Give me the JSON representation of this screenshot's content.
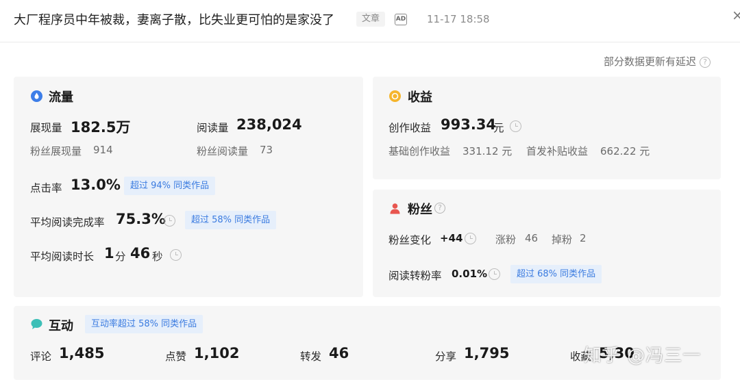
{
  "header": {
    "title": "大厂程序员中年被裁，妻离子散，比失业更可怕的是家没了",
    "type_tag": "文章",
    "ad_badge": "AD",
    "time": "11-17 18:58",
    "close_symbol": "×"
  },
  "delay_note": "部分数据更新有延迟",
  "help_symbol": "?",
  "flow": {
    "title": "流量",
    "impressions_label": "展现量",
    "impressions_value": "182.5万",
    "reads_label": "阅读量",
    "reads_value": "238,024",
    "fan_impressions_label": "粉丝展现量",
    "fan_impressions_value": "914",
    "fan_reads_label": "粉丝阅读量",
    "fan_reads_value": "73",
    "ctr_label": "点击率",
    "ctr_value": "13.0%",
    "ctr_badge": "超过 94% 同类作品",
    "completion_label": "平均阅读完成率",
    "completion_value": "75.3%",
    "completion_badge": "超过 58% 同类作品",
    "duration_label": "平均阅读时长",
    "duration_min": "1",
    "duration_min_unit": "分",
    "duration_sec": "46",
    "duration_sec_unit": "秒"
  },
  "income": {
    "title": "收益",
    "creation_label": "创作收益",
    "creation_value": "993.34",
    "creation_unit": "元",
    "base_label": "基础创作收益",
    "base_value": "331.12 元",
    "subsidy_label": "首发补贴收益",
    "subsidy_value": "662.22 元"
  },
  "fans": {
    "title": "粉丝",
    "change_label": "粉丝变化",
    "change_value": "+44",
    "gain_label": "涨粉",
    "gain_value": "46",
    "loss_label": "掉粉",
    "loss_value": "2",
    "convert_label": "阅读转粉率",
    "convert_value": "0.01%",
    "convert_badge": "超过 68% 同类作品"
  },
  "interaction": {
    "title": "互动",
    "badge": "互动率超过 58% 同类作品",
    "comments_label": "评论",
    "comments_value": "1,485",
    "likes_label": "点赞",
    "likes_value": "1,102",
    "reposts_label": "转发",
    "reposts_value": "46",
    "shares_label": "分享",
    "shares_value": "1,795",
    "favorites_label": "收藏",
    "favorites_value": "5,30"
  },
  "watermark": "知乎 @冯三一",
  "colors": {
    "flow_icon": "#3d7ee8",
    "income_icon": "#f5b52c",
    "fans_icon": "#e8564f",
    "interaction_icon": "#3dbfb7",
    "badge_text": "#3a7be0",
    "badge_bg": "#e6effb",
    "panel_bg": "#f6f6f6"
  },
  "icons": {
    "flow": "droplet-icon",
    "income": "coin-icon",
    "fans": "person-icon",
    "interaction": "chat-bubble-icon",
    "clock": "clock-icon",
    "help": "question-circle-icon",
    "close": "close-icon"
  }
}
